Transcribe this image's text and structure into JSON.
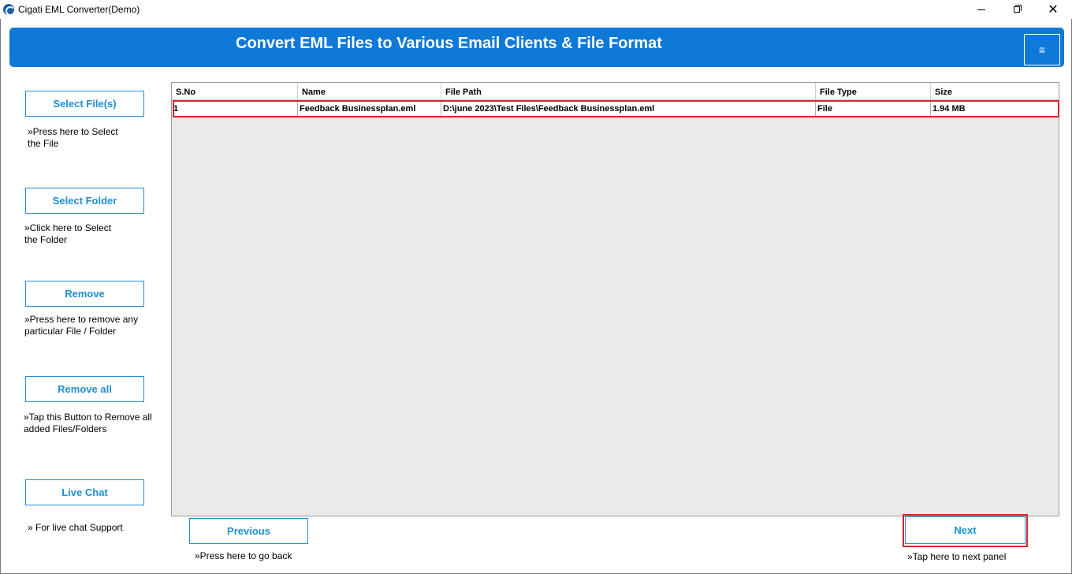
{
  "window": {
    "title": "Cigati EML Converter(Demo)",
    "close_glyph": "✕"
  },
  "banner": {
    "title": "Convert EML Files to Various Email Clients & File Format",
    "menu_glyph": "≡"
  },
  "sidebar": {
    "items": [
      {
        "label": "Select File(s)",
        "hint_line1": "»Press here to Select",
        "hint_line2": "the File"
      },
      {
        "label": "Select Folder",
        "hint_line1": "»Click here to Select",
        "hint_line2": "the Folder"
      },
      {
        "label": "Remove",
        "hint_line1": "»Press here to remove any",
        "hint_line2": "particular File / Folder"
      },
      {
        "label": "Remove all",
        "hint_line1": "»Tap this Button to Remove all",
        "hint_line2": "added Files/Folders"
      },
      {
        "label": "Live Chat",
        "hint_line1": "» For live chat Support",
        "hint_line2": ""
      }
    ]
  },
  "table": {
    "columns": [
      "S.No",
      "Name",
      "File Path",
      "File Type",
      "Size"
    ],
    "rows": [
      [
        "1",
        "Feedback Businessplan.eml",
        "D:\\june 2023\\Test Files\\Feedback Businessplan.eml",
        "File",
        "1.94 MB"
      ]
    ]
  },
  "nav": {
    "previous_label": "Previous",
    "previous_hint": "»Press here to go back",
    "next_label": "Next",
    "next_hint": "»Tap here to next panel"
  },
  "colors": {
    "accent": "#0f79d8",
    "button_text": "#1e8fd4",
    "highlight": "#d9232e"
  }
}
